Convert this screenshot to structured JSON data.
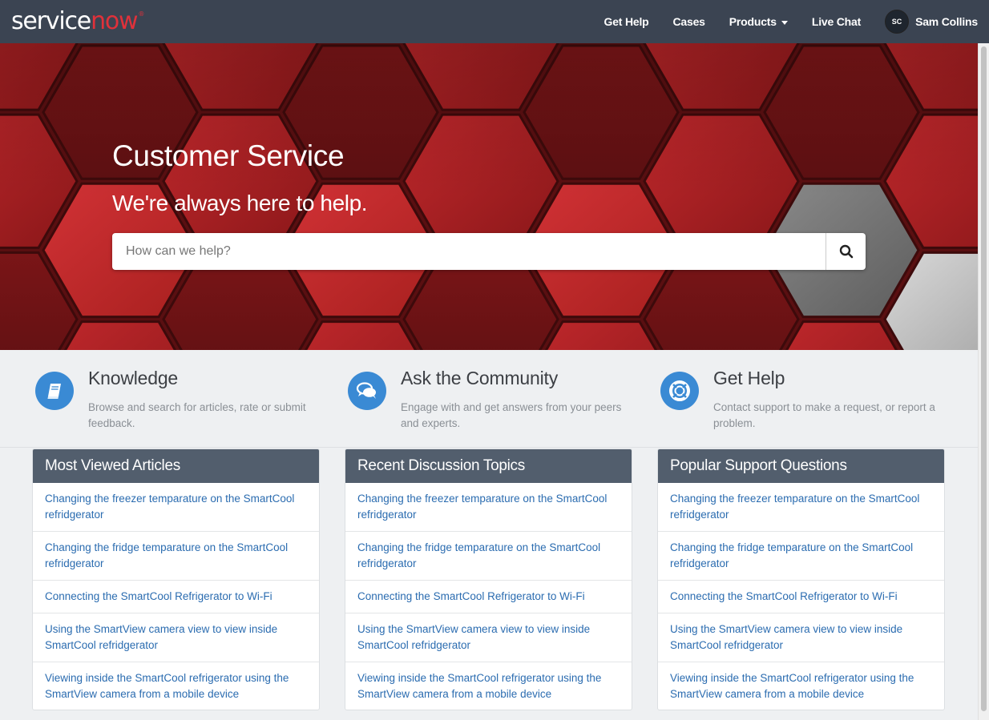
{
  "brand": {
    "part1": "service",
    "part2": "now",
    "tm": "®"
  },
  "nav": {
    "items": [
      {
        "label": "Get Help"
      },
      {
        "label": "Cases"
      },
      {
        "label": "Products"
      },
      {
        "label": "Live Chat"
      }
    ],
    "user": {
      "initials": "SC",
      "name": "Sam Collins"
    }
  },
  "hero": {
    "title": "Customer Service",
    "subtitle": "We're always here to help.",
    "search_placeholder": "How can we help?"
  },
  "features": [
    {
      "title": "Knowledge",
      "description": "Browse and search for articles, rate or submit feedback.",
      "icon": "book-icon"
    },
    {
      "title": "Ask the Community",
      "description": "Engage with and get answers from your peers and experts.",
      "icon": "chat-bubbles-icon"
    },
    {
      "title": "Get Help",
      "description": "Contact support to make a request, or report a problem.",
      "icon": "lifebuoy-icon"
    }
  ],
  "cards": [
    {
      "title": "Most Viewed Articles",
      "items": [
        "Changing the freezer temparature on the SmartCool refridgerator",
        "Changing the fridge temparature on the SmartCool refridgerator",
        "Connecting the SmartCool Refrigerator to Wi-Fi",
        "Using the SmartView camera view to view inside SmartCool refridgerator",
        "Viewing inside the SmartCool refrigerator using the SmartView camera from a mobile device"
      ]
    },
    {
      "title": "Recent Discussion Topics",
      "items": [
        "Changing the freezer temparature on the SmartCool refridgerator",
        "Changing the fridge temparature on the SmartCool refridgerator",
        "Connecting the SmartCool Refrigerator to Wi-Fi",
        "Using the SmartView camera view to view inside SmartCool refridgerator",
        "Viewing inside the SmartCool refrigerator using the SmartView camera from a mobile device"
      ]
    },
    {
      "title": "Popular Support Questions",
      "items": [
        "Changing the freezer temparature on the SmartCool refridgerator",
        "Changing the fridge temparature on the SmartCool refridgerator",
        "Connecting the SmartCool Refrigerator to Wi-Fi",
        "Using the SmartView camera view to view inside SmartCool refridgerator",
        "Viewing inside the SmartCool refrigerator using the SmartView camera from a mobile device"
      ]
    }
  ],
  "colors": {
    "navbar": "#3b4452",
    "accent": "#e0313a",
    "link": "#2b6cb0",
    "card_header": "#525e6d",
    "feature_icon": "#3a8ad4"
  }
}
